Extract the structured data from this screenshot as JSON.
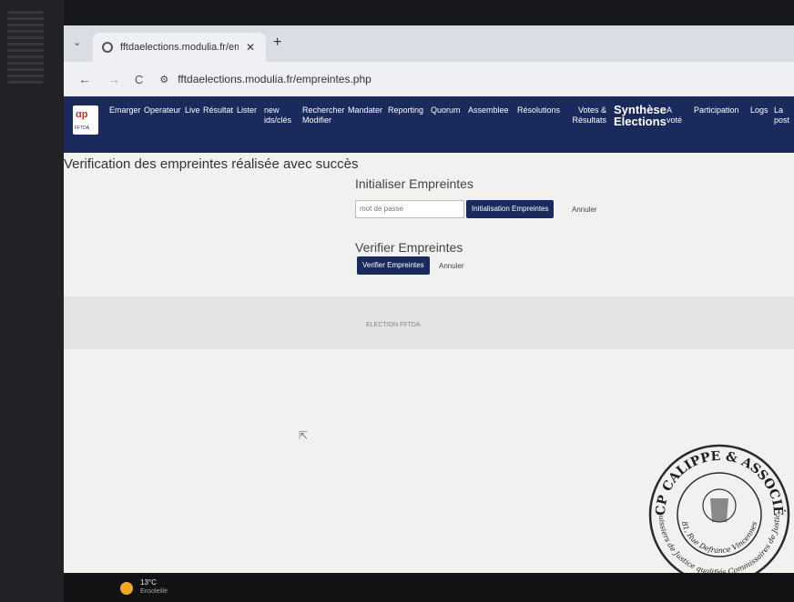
{
  "browser": {
    "tab_title": "fftdaelections.modulia.fr/empre",
    "tab_close": "✕",
    "new_tab": "+",
    "tab_dropdown": "⌄",
    "back": "←",
    "forward": "→",
    "reload": "C",
    "site_settings_icon": "⚙",
    "url": "fftdaelections.modulia.fr/empreintes.php"
  },
  "navbar": {
    "logo_text": "ɑp",
    "logo_sub": "FFTDA",
    "items": [
      "Emarger",
      "Operateur",
      "Live",
      "Résultat",
      "Lister",
      "new ids/clés",
      "Rechercher Modifier",
      "Mandater",
      "Reporting",
      "Quorum",
      "Assemblee",
      "Résolutions",
      "Votes & Résultats",
      "A voté",
      "Participation",
      "Logs",
      "La post"
    ],
    "synthese": "Synthèse Elections",
    "colors": {
      "background": "#1b2a5c"
    }
  },
  "main": {
    "success_message": "Verification des empreintes réalisée avec succès",
    "init_section": {
      "title": "Initialiser Empreintes",
      "password_placeholder": "mot de passe",
      "button": "Initialisation Empreintes",
      "cancel": "Annuler"
    },
    "verify_section": {
      "title": "Verifier Empreintes",
      "button": "Verifier Empreintes",
      "cancel": "Annuler"
    },
    "election_label": "ELECTION FFTDA"
  },
  "stamp": {
    "top_text": "SCP CALIPPE & ASSOCIÉS",
    "middle_text": "81, Rue Defrance Vincennes",
    "bottom_text": "Huissiers de Justice qualifiés Commissaires de Justice"
  },
  "taskbar": {
    "temperature": "13°C",
    "condition": "Ensoleillé"
  }
}
